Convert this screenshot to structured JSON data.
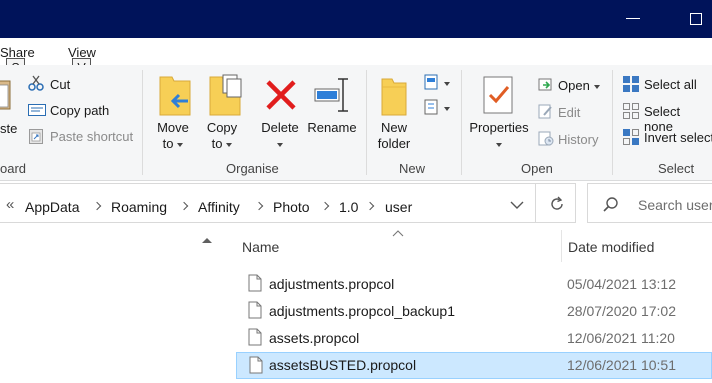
{
  "window": {
    "title_bar_color": "#00135a"
  },
  "tabs": {
    "share_label": "Share",
    "share_keytip": "S",
    "view_label": "View",
    "view_keytip": "V"
  },
  "ribbon": {
    "clipboard": {
      "paste_partial": "ste",
      "cut": "Cut",
      "copy_path": "Copy path",
      "paste_shortcut": "Paste shortcut",
      "group_label_partial": "oard"
    },
    "organise": {
      "move_to_line1": "Move",
      "move_to_line2": "to",
      "copy_to_line1": "Copy",
      "copy_to_line2": "to",
      "delete": "Delete",
      "rename": "Rename",
      "group_label": "Organise"
    },
    "new": {
      "new_folder_line1": "New",
      "new_folder_line2": "folder",
      "group_label": "New"
    },
    "open": {
      "properties": "Properties",
      "open": "Open",
      "edit": "Edit",
      "history": "History",
      "group_label": "Open"
    },
    "select": {
      "select_all": "Select all",
      "select_none": "Select none",
      "invert_selection": "Invert selecti",
      "group_label": "Select"
    }
  },
  "address": {
    "breadcrumbs": [
      "AppData",
      "Roaming",
      "Affinity",
      "Photo",
      "1.0",
      "user"
    ],
    "search_placeholder": "Search user"
  },
  "file_list": {
    "columns": {
      "name": "Name",
      "date_modified": "Date modified"
    },
    "files": [
      {
        "name": "adjustments.propcol",
        "date": "05/04/2021 13:12",
        "selected": false
      },
      {
        "name": "adjustments.propcol_backup1",
        "date": "28/07/2020 17:02",
        "selected": false
      },
      {
        "name": "assets.propcol",
        "date": "12/06/2021 11:20",
        "selected": false
      },
      {
        "name": "assetsBUSTED.propcol",
        "date": "12/06/2021 10:51",
        "selected": true
      }
    ]
  }
}
